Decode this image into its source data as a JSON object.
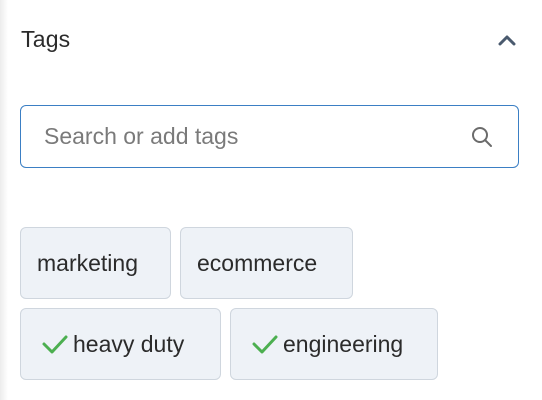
{
  "tags_panel": {
    "title": "Tags",
    "collapse_icon": "chevron-up-icon",
    "search": {
      "placeholder": "Search or add tags",
      "value": "",
      "icon": "search-icon"
    },
    "tags": [
      {
        "label": "marketing",
        "selected": false
      },
      {
        "label": "ecommerce",
        "selected": false
      },
      {
        "label": "heavy duty",
        "selected": true
      },
      {
        "label": "engineering",
        "selected": true
      }
    ]
  },
  "colors": {
    "accent_border": "#3b7fc4",
    "tag_background": "#eef2f7",
    "tag_border": "#cfd6de",
    "check_green": "#4caf50",
    "chevron": "#4a5a6e"
  }
}
